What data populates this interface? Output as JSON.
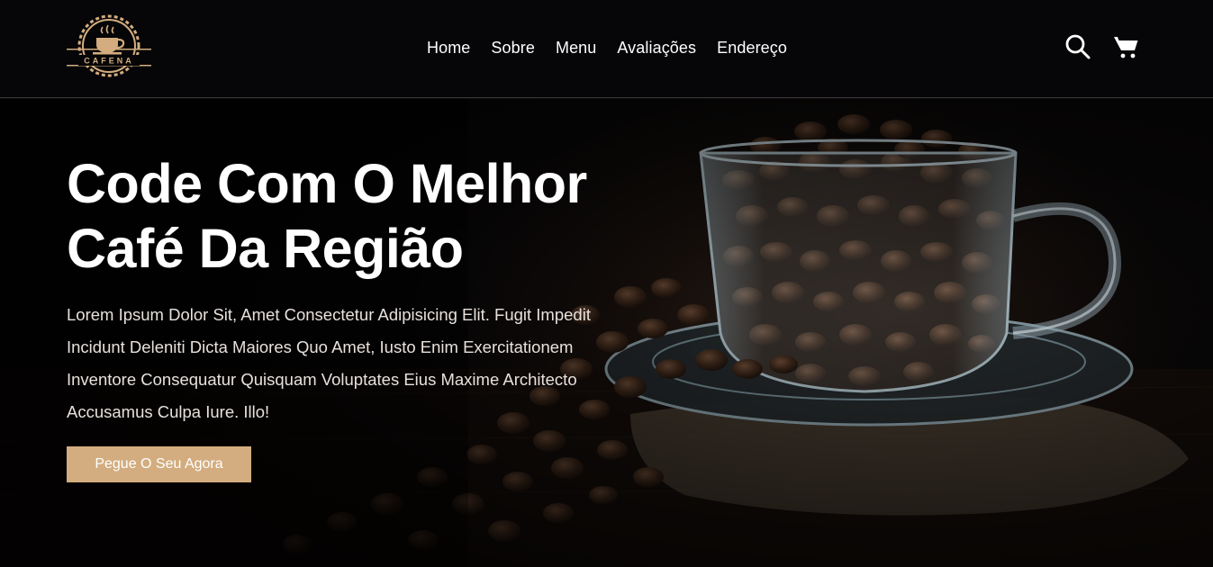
{
  "brand": {
    "logo_text": "CAFENA",
    "logo_color": "#d3ad7f"
  },
  "nav": {
    "items": [
      "Home",
      "Sobre",
      "Menu",
      "Avaliações",
      "Endereço"
    ]
  },
  "header_icons": [
    "search-icon",
    "cart-icon"
  ],
  "hero": {
    "title": "Code Com O Melhor Café Da Região",
    "text": "Lorem Ipsum Dolor Sit, Amet Consectetur Adipisicing Elit. Fugit Impedit Incidunt Deleniti Dicta Maiores Quo Amet, Iusto Enim Exercitationem Inventore Consequatur Quisquam Voluptates Eius Maxime Architecto Accusamus Culpa Iure. Illo!",
    "button_label": "Pegue O Seu Agora"
  },
  "colors": {
    "accent": "#d3ad7f",
    "header_bg": "#060507",
    "text": "#ffffff"
  }
}
